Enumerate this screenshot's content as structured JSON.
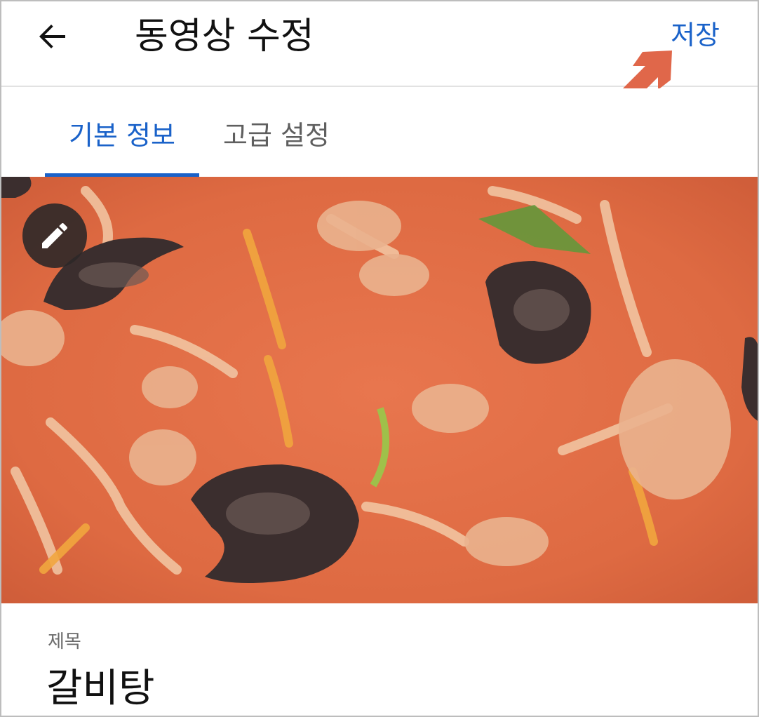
{
  "header": {
    "title": "동영상 수정",
    "save_label": "저장",
    "back_icon": "arrow-left-icon"
  },
  "tabs": [
    {
      "label": "기본 정보",
      "active": true
    },
    {
      "label": "고급 설정",
      "active": false
    }
  ],
  "thumbnail": {
    "edit_icon": "pencil-icon"
  },
  "form": {
    "title_label": "제목",
    "title_value": "갈비탕"
  },
  "colors": {
    "accent": "#1a62c9",
    "annotation": "#e0674a"
  }
}
